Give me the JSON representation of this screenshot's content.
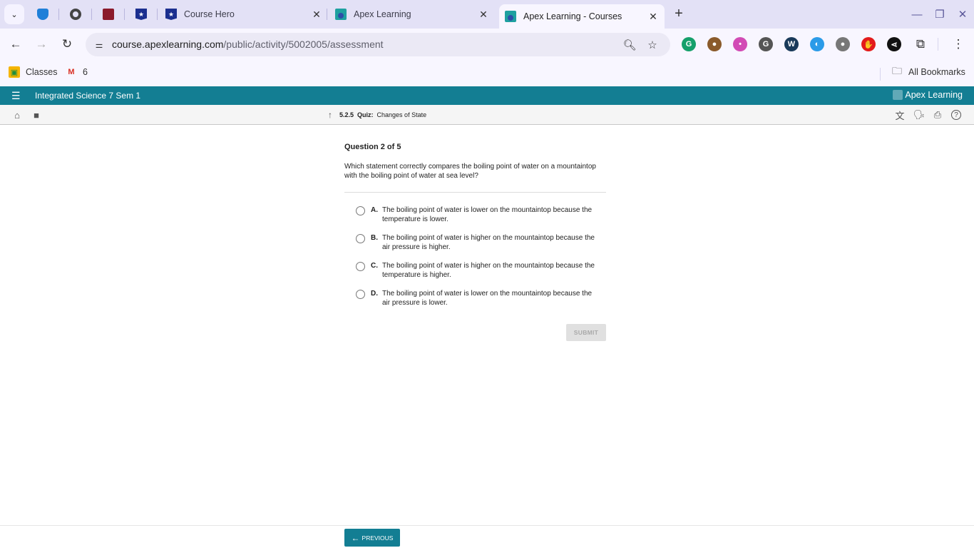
{
  "browser": {
    "tabs": [
      {
        "title": "Course Hero",
        "icon": "course-hero-favicon",
        "active": false
      },
      {
        "title": "Apex Learning",
        "icon": "apex-favicon",
        "active": false
      },
      {
        "title": "Apex Learning - Courses",
        "icon": "apex-favicon",
        "active": true
      }
    ],
    "pinned_tabs": [
      "vs-shield-icon",
      "chrome-icon",
      "cat-mask-icon",
      "star-shield-icon"
    ],
    "url_domain": "course.apexlearning.com",
    "url_path": "/public/activity/5002005/assessment",
    "extensions": [
      {
        "name": "grammarly-icon",
        "color": "#15a06b",
        "glyph": "G"
      },
      {
        "name": "cookie-icon",
        "color": "#8a5a2b",
        "glyph": "●"
      },
      {
        "name": "colorful-bot-icon",
        "color": "#d24bb5",
        "glyph": "•"
      },
      {
        "name": "g-feather-icon",
        "color": "#555555",
        "glyph": "G"
      },
      {
        "name": "w-extension-icon",
        "color": "#1a3a5a",
        "glyph": "W"
      },
      {
        "name": "blue-planet-icon",
        "color": "#2b9be8",
        "glyph": "◐"
      },
      {
        "name": "lightbulb-icon",
        "color": "#777777",
        "glyph": "●"
      },
      {
        "name": "adblock-icon",
        "color": "#e31b1b",
        "glyph": "✋"
      },
      {
        "name": "share-node-icon",
        "color": "#111111",
        "glyph": "⋖"
      }
    ],
    "bookmarks": [
      {
        "label": "Classes",
        "icon": "google-classroom-icon"
      },
      {
        "label": "6",
        "icon": "gmail-icon"
      }
    ],
    "all_bookmarks_label": "All Bookmarks"
  },
  "app": {
    "course_title": "Integrated Science 7 Sem 1",
    "brand": "Apex Learning",
    "breadcrumb": {
      "number": "5.2.5",
      "type": "Quiz:",
      "title": "Changes of State"
    }
  },
  "question": {
    "header": "Question 2 of 5",
    "prompt": "Which statement correctly compares the boiling point of water on a mountaintop with the boiling point of water at sea level?",
    "options": [
      {
        "letter": "A.",
        "text": "The boiling point of water is lower on the mountaintop because the temperature is lower.",
        "selected": false
      },
      {
        "letter": "B.",
        "text": "The boiling point of water is higher on the mountaintop because the air pressure is higher.",
        "selected": false
      },
      {
        "letter": "C.",
        "text": "The boiling point of water is higher on the mountaintop because the temperature is higher.",
        "selected": false
      },
      {
        "letter": "D.",
        "text": "The boiling point of water is lower on the mountaintop because the air pressure is lower.",
        "selected": false
      }
    ],
    "submit_label": "SUBMIT"
  },
  "footer": {
    "previous_label": "PREVIOUS"
  }
}
